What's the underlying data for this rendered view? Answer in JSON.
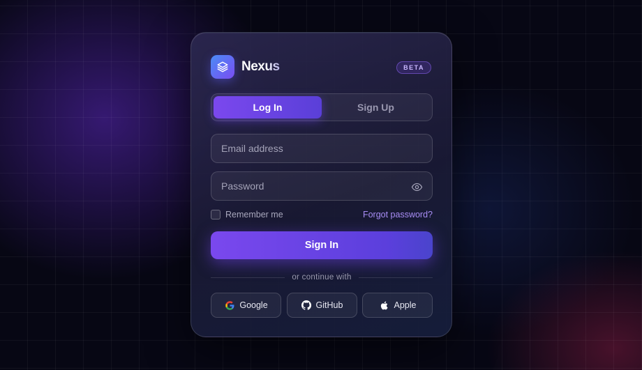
{
  "brand": {
    "name": "Nexus",
    "badge": "BETA",
    "logo_icon": "layers-icon"
  },
  "tabs": [
    {
      "label": "Log In",
      "active": true
    },
    {
      "label": "Sign Up",
      "active": false
    }
  ],
  "form": {
    "email": {
      "placeholder": "Email address",
      "value": ""
    },
    "password": {
      "placeholder": "Password",
      "value": "",
      "toggle_icon": "eye-icon"
    },
    "remember_label": "Remember me",
    "remember_checked": false,
    "forgot_label": "Forgot password?",
    "submit_label": "Sign In"
  },
  "divider_text": "or continue with",
  "social": [
    {
      "label": "Google",
      "icon": "google-icon"
    },
    {
      "label": "GitHub",
      "icon": "github-icon"
    },
    {
      "label": "Apple",
      "icon": "apple-icon"
    }
  ],
  "colors": {
    "accent": "#7B48EE",
    "accent_secondary": "#5A3FD8",
    "link": "#A88DF5",
    "background": "#070714"
  }
}
